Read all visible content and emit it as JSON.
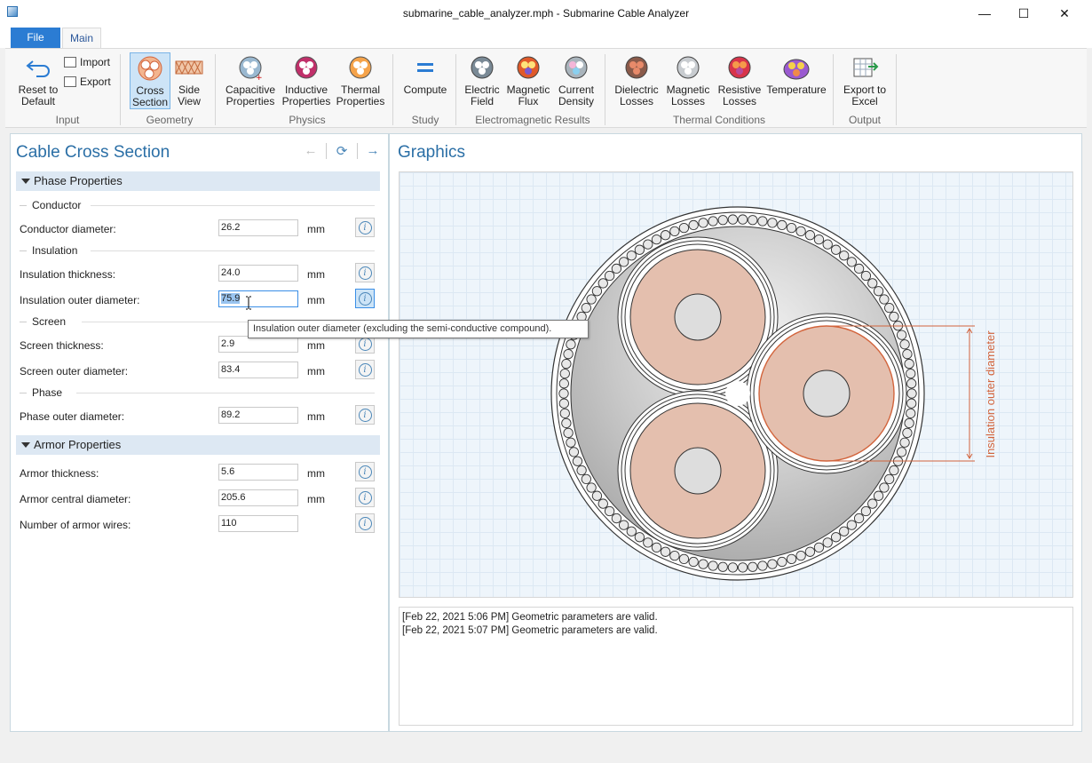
{
  "window": {
    "title": "submarine_cable_analyzer.mph - Submarine Cable Analyzer",
    "minimize": "—",
    "maximize": "☐",
    "close": "✕"
  },
  "ribbon": {
    "tabs": [
      "File",
      "Main"
    ],
    "input": {
      "group": "Input",
      "reset": "Reset to\nDefault",
      "import": "Import",
      "export": "Export"
    },
    "geometry": {
      "group": "Geometry",
      "cross_section": "Cross\nSection",
      "side_view": "Side\nView"
    },
    "physics": {
      "group": "Physics",
      "capacitive": "Capacitive\nProperties",
      "inductive": "Inductive\nProperties",
      "thermal": "Thermal\nProperties"
    },
    "study": {
      "group": "Study",
      "compute": "Compute"
    },
    "em_results": {
      "group": "Electromagnetic Results",
      "electric_field": "Electric\nField",
      "magnetic_flux": "Magnetic\nFlux",
      "current_density": "Current\nDensity"
    },
    "thermal": {
      "group": "Thermal Conditions",
      "dielectric": "Dielectric\nLosses",
      "magnetic_losses": "Magnetic\nLosses",
      "resistive": "Resistive\nLosses",
      "temperature": "Temperature"
    },
    "output": {
      "group": "Output",
      "export_excel": "Export to\nExcel"
    }
  },
  "left_panel": {
    "title": "Cable Cross Section",
    "phase_section": "Phase Properties",
    "armor_section": "Armor Properties",
    "subheads": {
      "conductor": "Conductor",
      "insulation": "Insulation",
      "screen": "Screen",
      "phase": "Phase"
    },
    "fields": {
      "conductor_diameter": {
        "label": "Conductor diameter:",
        "value": "26.2",
        "unit": "mm"
      },
      "insulation_thickness": {
        "label": "Insulation thickness:",
        "value": "24.0",
        "unit": "mm"
      },
      "insulation_outer_diameter": {
        "label": "Insulation outer diameter:",
        "value": "75.9",
        "unit": "mm"
      },
      "screen_thickness": {
        "label": "Screen thickness:",
        "value": "2.9",
        "unit": "mm"
      },
      "screen_outer_diameter": {
        "label": "Screen outer diameter:",
        "value": "83.4",
        "unit": "mm"
      },
      "phase_outer_diameter": {
        "label": "Phase outer diameter:",
        "value": "89.2",
        "unit": "mm"
      },
      "armor_thickness": {
        "label": "Armor thickness:",
        "value": "5.6",
        "unit": "mm"
      },
      "armor_central_diameter": {
        "label": "Armor central diameter:",
        "value": "205.6",
        "unit": "mm"
      },
      "number_of_armor_wires": {
        "label": "Number of armor wires:",
        "value": "110",
        "unit": ""
      }
    },
    "tooltip": "Insulation outer diameter (excluding the semi-conductive compound)."
  },
  "right_panel": {
    "title": "Graphics",
    "dimension_label": "Insulation outer diameter",
    "log": [
      "[Feb 22, 2021 5:06 PM] Geometric parameters are valid.",
      "[Feb 22, 2021 5:07 PM] Geometric parameters are valid."
    ]
  },
  "colors": {
    "accent": "#2b7cd3",
    "title_blue": "#2b6fa6",
    "insulation": "#e4bfae",
    "dimension": "#d2643c"
  }
}
